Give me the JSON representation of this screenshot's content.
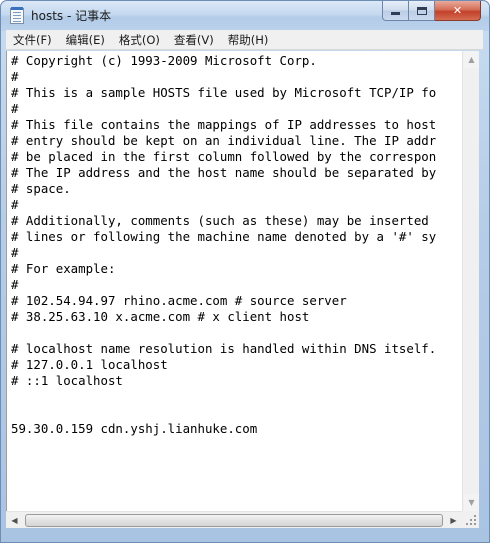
{
  "window": {
    "title": "hosts - 记事本",
    "controls": {
      "minimize": "",
      "maximize": "",
      "close": "✕"
    }
  },
  "menu": [
    {
      "label": "文件(F)"
    },
    {
      "label": "编辑(E)"
    },
    {
      "label": "格式(O)"
    },
    {
      "label": "查看(V)"
    },
    {
      "label": "帮助(H)"
    }
  ],
  "content": {
    "lines": [
      "# Copyright (c) 1993-2009 Microsoft Corp.",
      "#",
      "# This is a sample HOSTS file used by Microsoft TCP/IP fo",
      "#",
      "# This file contains the mappings of IP addresses to host",
      "# entry should be kept on an individual line. The IP addr",
      "# be placed in the first column followed by the correspon",
      "# The IP address and the host name should be separated by",
      "# space.",
      "#",
      "# Additionally, comments (such as these) may be inserted",
      "# lines or following the machine name denoted by a '#' sy",
      "#",
      "# For example:",
      "#",
      "# 102.54.94.97 rhino.acme.com # source server",
      "# 38.25.63.10 x.acme.com # x client host",
      "",
      "# localhost name resolution is handled within DNS itself.",
      "# 127.0.0.1 localhost",
      "# ::1 localhost",
      "",
      "",
      "59.30.0.159 cdn.yshj.lianhuke.com"
    ]
  },
  "scrollbars": {
    "up_arrow": "▲",
    "down_arrow": "▼",
    "left_arrow": "◀",
    "right_arrow": "▶"
  }
}
